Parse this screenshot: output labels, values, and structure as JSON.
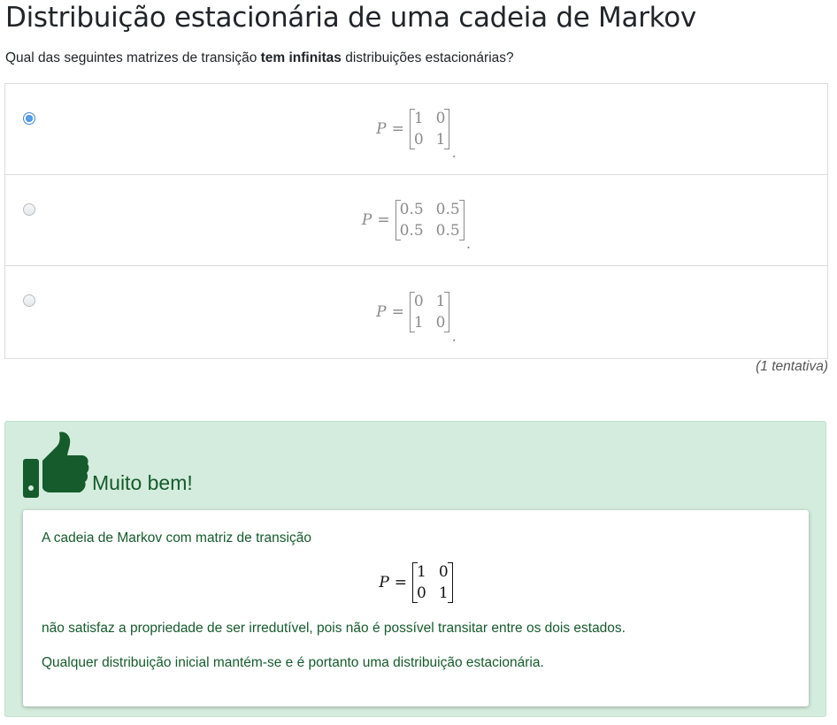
{
  "page": {
    "title": "Distribuição estacionária de uma cadeia de Markov",
    "question_prefix": "Qual das seguintes matrizes de transição ",
    "question_bold": "tem infinitas",
    "question_suffix": " distribuições estacionárias?"
  },
  "options": [
    {
      "selected": true,
      "var": "P",
      "eq": "=",
      "matrix": [
        "1",
        "0",
        "0",
        "1"
      ],
      "end": "."
    },
    {
      "selected": false,
      "var": "P",
      "eq": "=",
      "matrix": [
        "0.5",
        "0.5",
        "0.5",
        "0.5"
      ],
      "end": "."
    },
    {
      "selected": false,
      "var": "P",
      "eq": "=",
      "matrix": [
        "0",
        "1",
        "1",
        "0"
      ],
      "end": "."
    }
  ],
  "attempts": "(1 tentativa)",
  "feedback": {
    "icon": "thumbs-up-icon",
    "title": "Muito bem!",
    "line1": "A cadeia de Markov com matriz de transição",
    "math_var": "P",
    "math_eq": "=",
    "math_matrix": [
      "1",
      "0",
      "0",
      "1"
    ],
    "line2": "não satisfaz a propriedade de ser irredutível, pois não é possível transitar entre os dois estados.",
    "line3": "Qualquer distribuição inicial mantém-se e é portanto uma distribuição estacionária."
  },
  "colors": {
    "feedback_bg": "#d4ecdd",
    "feedback_text": "#155b2c",
    "radio_selected": "#5aa2ee"
  }
}
